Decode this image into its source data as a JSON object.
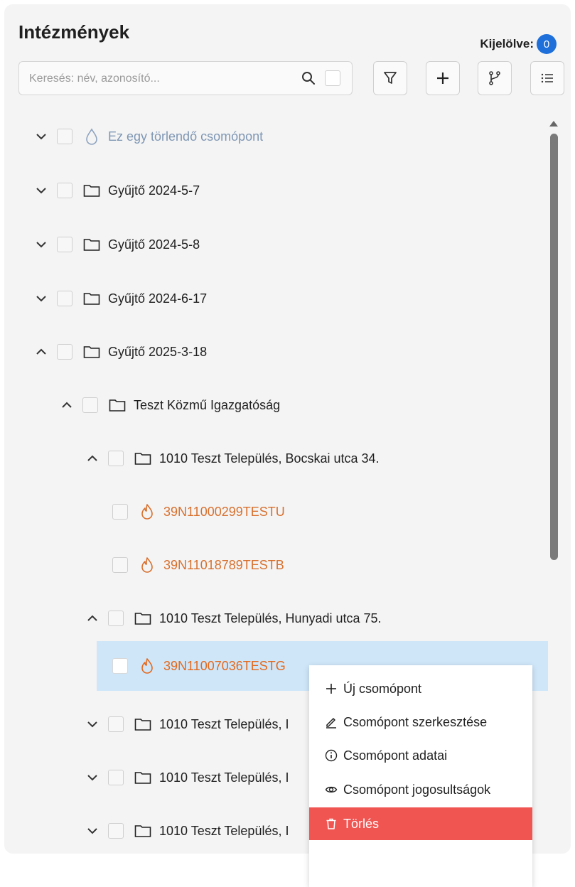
{
  "header": {
    "title": "Intézmények",
    "selected_label": "Kijelölve:",
    "selected_count": "0"
  },
  "search": {
    "placeholder": "Keresés: név, azonosító..."
  },
  "toolbar": {
    "buttons": [
      "filter-icon",
      "plus-icon",
      "branch-icon",
      "list-icon"
    ]
  },
  "tree": {
    "rows": [
      {
        "label": "Ez egy törlendő csomópont",
        "icon": "drop-icon",
        "expanded": false,
        "style": "blue"
      },
      {
        "label": "Gyűjtő 2024-5-7",
        "icon": "folder-icon",
        "expanded": false
      },
      {
        "label": "Gyűjtő 2024-5-8",
        "icon": "folder-icon",
        "expanded": false
      },
      {
        "label": "Gyűjtő 2024-6-17",
        "icon": "folder-icon",
        "expanded": false
      },
      {
        "label": "Gyűjtő 2025-3-18",
        "icon": "folder-icon",
        "expanded": true
      },
      {
        "label": "Teszt Közmű Igazgatóság",
        "icon": "folder-icon",
        "expanded": true
      },
      {
        "label": "1010 Teszt Település, Bocskai utca 34.",
        "icon": "folder-icon",
        "expanded": true
      },
      {
        "label": "39N11000299TESTU",
        "icon": "flame-icon",
        "style": "orange"
      },
      {
        "label": "39N11018789TESTB",
        "icon": "flame-icon",
        "style": "orange"
      },
      {
        "label": "1010 Teszt Település, Hunyadi utca 75.",
        "icon": "folder-icon",
        "expanded": true
      },
      {
        "label": "39N11007036TESTG",
        "icon": "flame-icon",
        "style": "orange",
        "selected": true
      },
      {
        "label": "1010 Teszt Település, I",
        "icon": "folder-icon",
        "expanded": false
      },
      {
        "label": "1010 Teszt Település, I",
        "icon": "folder-icon",
        "expanded": false
      },
      {
        "label": "1010 Teszt Település, I",
        "icon": "folder-icon",
        "expanded": false
      }
    ]
  },
  "context_menu": {
    "items": [
      {
        "label": "Új csomópont",
        "icon": "plus-icon"
      },
      {
        "label": "Csomópont szerkesztése",
        "icon": "pencil-icon"
      },
      {
        "label": "Csomópont adatai",
        "icon": "info-icon"
      },
      {
        "label": "Csomópont jogosultságok",
        "icon": "eye-icon"
      },
      {
        "label": "Törlés",
        "icon": "trash-icon",
        "danger": true
      }
    ]
  },
  "colors": {
    "accent": "#1e6fd9",
    "selected_row": "#cfe6f9",
    "danger": "#f05552",
    "orange_text": "#d8702e"
  }
}
